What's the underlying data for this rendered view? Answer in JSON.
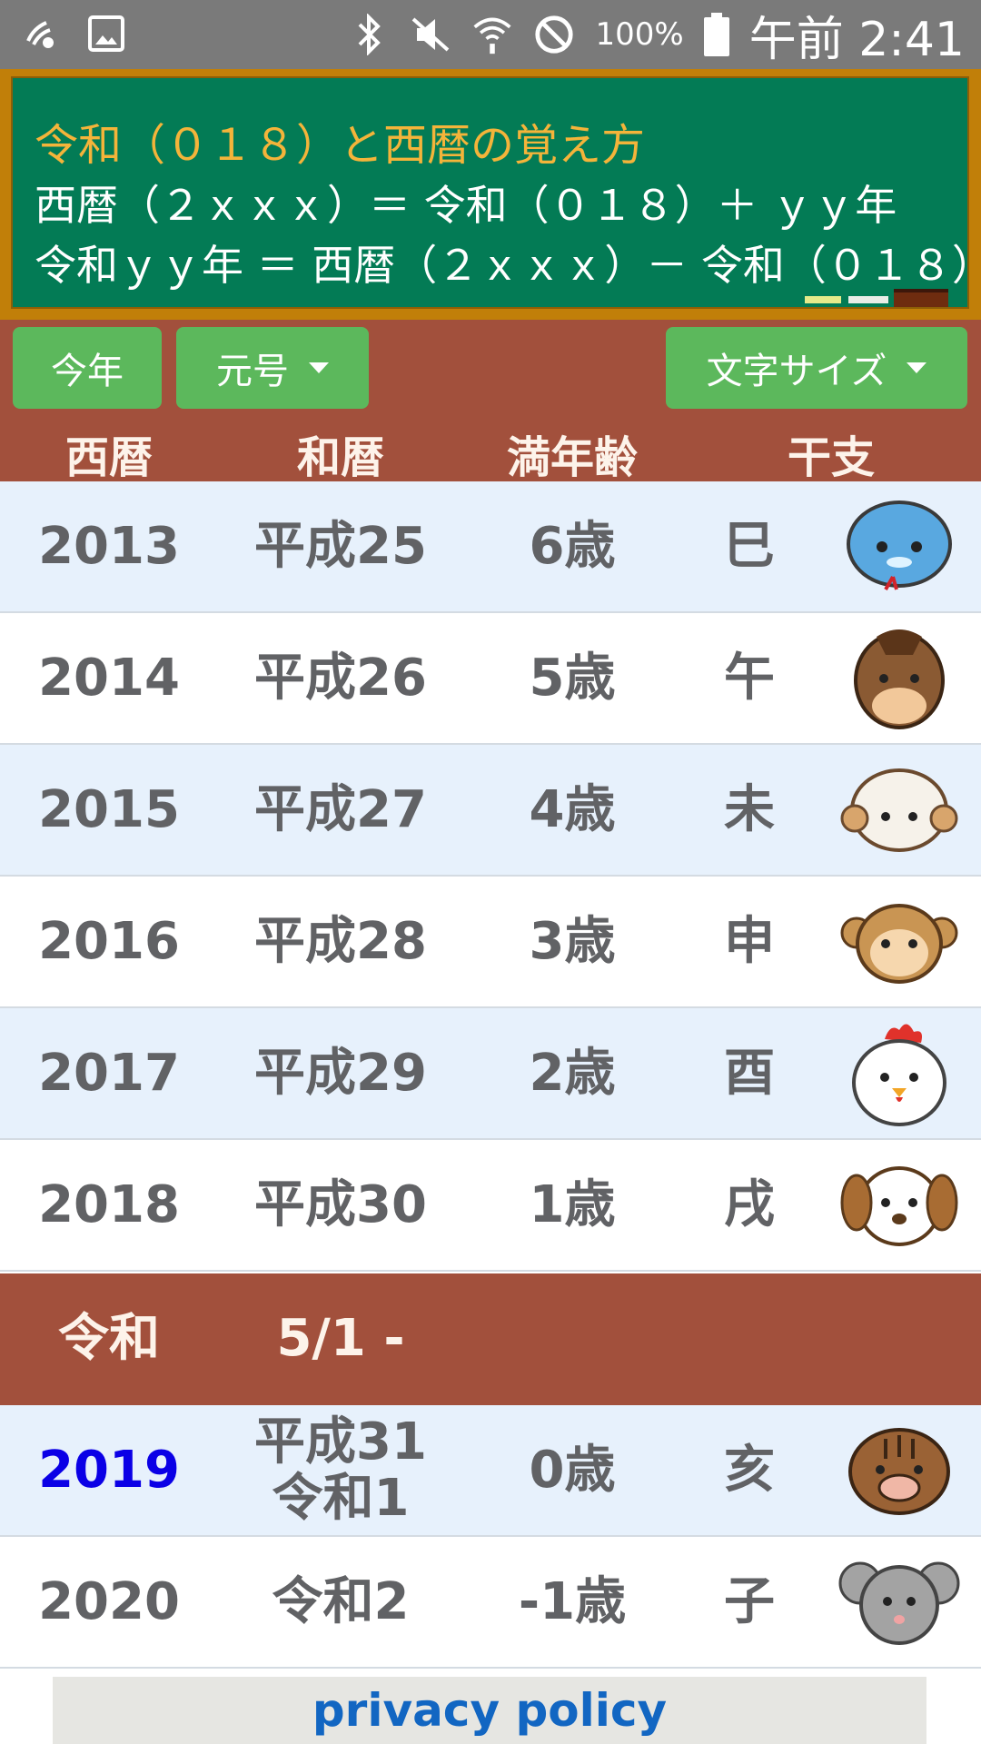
{
  "status_bar": {
    "battery_percent": "100%",
    "time": "午前 2:41",
    "icons": [
      "nfc-icon",
      "image-icon",
      "bluetooth-icon",
      "mute-icon",
      "wifi-icon",
      "do-not-disturb-icon",
      "battery-icon"
    ]
  },
  "board": {
    "title": "令和（０１８）と西暦の覚え方",
    "line1": "西暦（２ｘｘｘ）＝ 令和（０１８）＋ ｙｙ年",
    "line2": "令和ｙｙ年 ＝ 西暦（２ｘｘｘ）－ 令和（０１８）",
    "colors": {
      "board": "#037b55",
      "frame": "#c17f09",
      "title": "#f4b43a"
    }
  },
  "controls": {
    "this_year_label": "今年",
    "era_label": "元号",
    "font_size_label": "文字サイズ",
    "button_color": "#5cb85c",
    "panel_color": "#a2503c"
  },
  "table": {
    "headers": [
      "西暦",
      "和暦",
      "満年齢",
      "干支"
    ],
    "rows_before": [
      {
        "year": "2013",
        "jp": "平成25",
        "jp2": "",
        "age": "6歳",
        "eto": "巳",
        "animal": "snake-icon"
      },
      {
        "year": "2014",
        "jp": "平成26",
        "jp2": "",
        "age": "5歳",
        "eto": "午",
        "animal": "horse-icon"
      },
      {
        "year": "2015",
        "jp": "平成27",
        "jp2": "",
        "age": "4歳",
        "eto": "未",
        "animal": "sheep-icon"
      },
      {
        "year": "2016",
        "jp": "平成28",
        "jp2": "",
        "age": "3歳",
        "eto": "申",
        "animal": "monkey-icon"
      },
      {
        "year": "2017",
        "jp": "平成29",
        "jp2": "",
        "age": "2歳",
        "eto": "酉",
        "animal": "rooster-icon"
      },
      {
        "year": "2018",
        "jp": "平成30",
        "jp2": "",
        "age": "1歳",
        "eto": "戌",
        "animal": "dog-icon"
      }
    ],
    "era_change": {
      "name": "令和",
      "date": "5/1 -"
    },
    "rows_after": [
      {
        "year": "2019",
        "jp": "平成31",
        "jp2": "令和1",
        "age": "0歳",
        "eto": "亥",
        "animal": "boar-icon",
        "current": true
      },
      {
        "year": "2020",
        "jp": "令和2",
        "jp2": "",
        "age": "-1歳",
        "eto": "子",
        "animal": "rat-icon"
      }
    ]
  },
  "footer": {
    "privacy_label": "privacy policy"
  }
}
